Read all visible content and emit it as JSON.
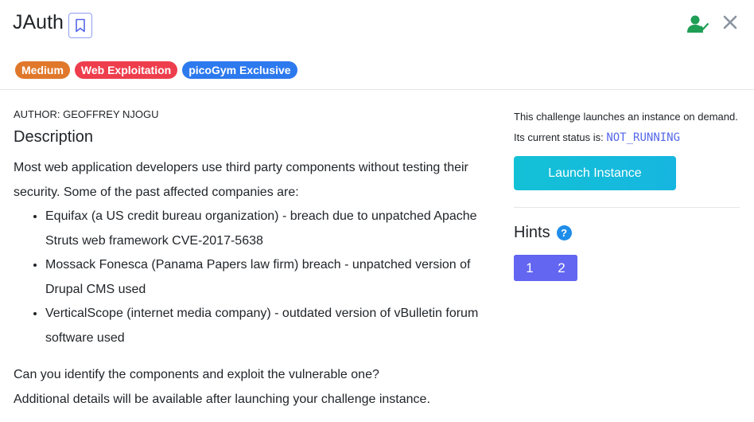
{
  "header": {
    "title": "JAuth",
    "badges": [
      {
        "label": "Medium",
        "color": "#e0782b"
      },
      {
        "label": "Web Exploitation",
        "color": "#ee3d4c"
      },
      {
        "label": "picoGym Exclusive",
        "color": "#2d79ee"
      }
    ]
  },
  "main": {
    "author": "AUTHOR: GEOFFREY NJOGU",
    "description_heading": "Description",
    "intro": "Most web application developers use third party components without testing their security. Some of the past affected companies are:",
    "items": [
      "Equifax (a US credit bureau organization) - breach due to unpatched Apache Struts web framework CVE-2017-5638",
      "Mossack Fonesca (Panama Papers law firm) breach - unpatched version of Drupal CMS used",
      "VerticalScope (internet media company) - outdated version of vBulletin forum software used"
    ],
    "question": "Can you identify the components and exploit the vulnerable one?",
    "details": "Additional details will be available after launching your challenge instance."
  },
  "sidebar": {
    "launch_note": "This challenge launches an instance on demand.",
    "status_label": "Its current status is:",
    "status_value": "NOT_RUNNING",
    "launch_button": "Launch Instance",
    "hints_title": "Hints",
    "help_glyph": "?",
    "hints": [
      "1",
      "2"
    ]
  },
  "icons": {
    "bookmark": "bookmark-icon",
    "user_check": "user-check-icon",
    "close": "close-icon",
    "help": "help-icon"
  },
  "colors": {
    "accent": "#6266f1",
    "launch": "#13c1d6",
    "status": "#5567e8"
  }
}
